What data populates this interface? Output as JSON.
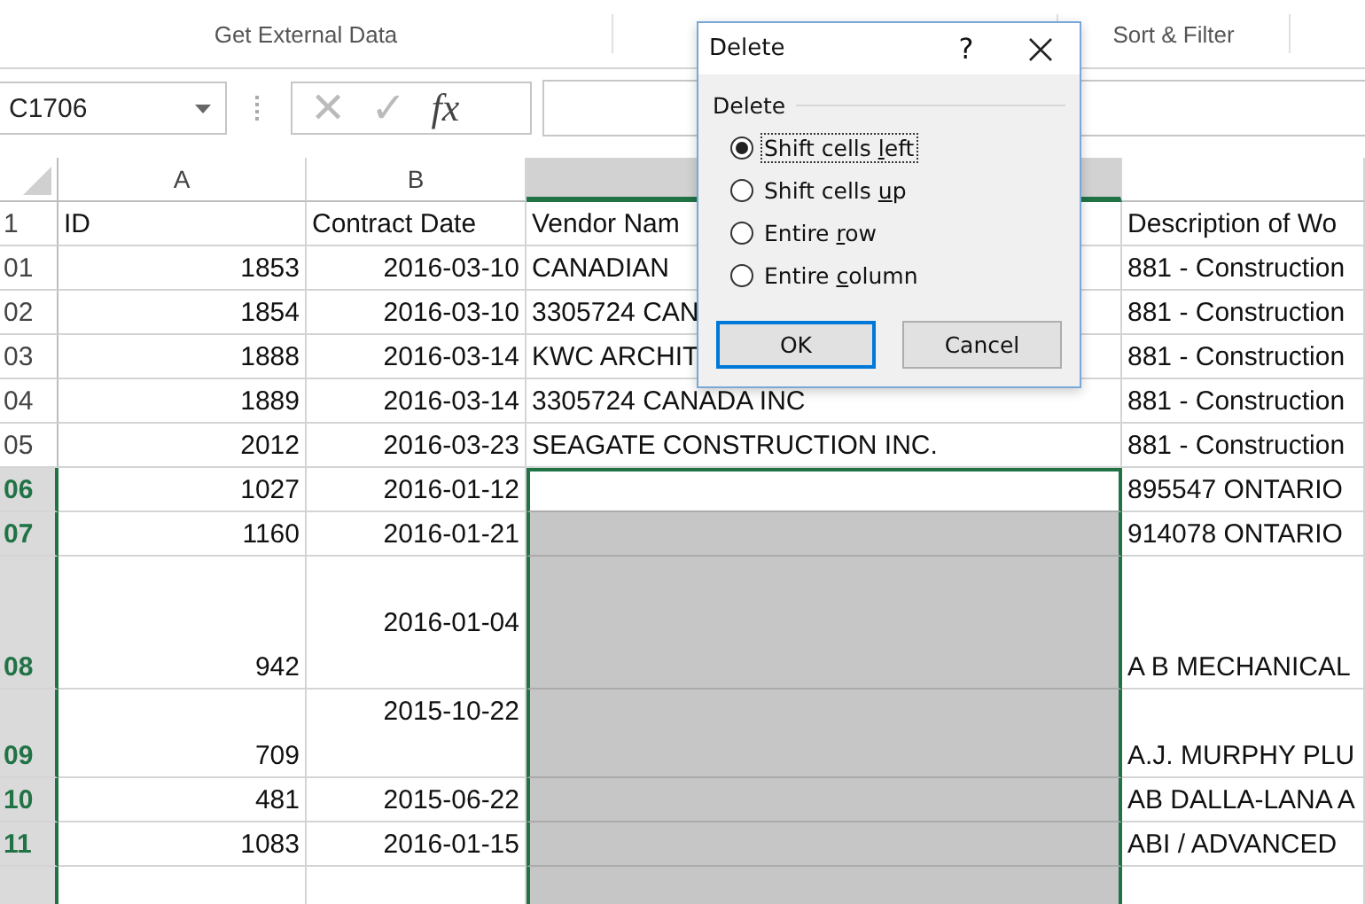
{
  "ribbon_groups": [
    "Get External Data",
    "Sort & Filter"
  ],
  "formula_bar": {
    "name_box": "C1706",
    "cancel_icon": "✕",
    "enter_icon": "✓",
    "function_label": "fx"
  },
  "columns": [
    {
      "label": "A",
      "selected": false
    },
    {
      "label": "B",
      "selected": false
    },
    {
      "selected": true
    },
    {
      "selected": false
    }
  ],
  "rows": [
    {
      "number": "1",
      "kind": "single",
      "selected": false,
      "header": true,
      "id": "ID",
      "date": "Contract Date",
      "vendor": "Vendor Nam",
      "vendor_selected": false,
      "description": "Description of Wo"
    },
    {
      "number": "01",
      "kind": "single",
      "selected": false,
      "id": "1853",
      "date": "2016-03-10",
      "vendor": "CANADIAN",
      "vendor_selected": false,
      "description": "881 - Construction"
    },
    {
      "number": "02",
      "kind": "single",
      "selected": false,
      "id": "1854",
      "date": "2016-03-10",
      "vendor": "3305724 CAN",
      "vendor_selected": false,
      "description": "881 - Construction"
    },
    {
      "number": "03",
      "kind": "single",
      "selected": false,
      "id": "1888",
      "date": "2016-03-14",
      "vendor": "KWC ARCHIT",
      "vendor_selected": false,
      "description": "881 - Construction"
    },
    {
      "number": "04",
      "kind": "single",
      "selected": false,
      "id": "1889",
      "date": "2016-03-14",
      "vendor": "3305724 CANADA INC",
      "vendor_selected": false,
      "description": "881 - Construction"
    },
    {
      "number": "05",
      "kind": "single",
      "selected": false,
      "id": "2012",
      "date": "2016-03-23",
      "vendor": "SEAGATE CONSTRUCTION INC.",
      "vendor_selected": false,
      "description": "881 - Construction"
    },
    {
      "number": "06",
      "kind": "single",
      "selected": true,
      "id": "1027",
      "date": "2016-01-12",
      "vendor_selected": true,
      "active": true,
      "description": "895547 ONTARIO"
    },
    {
      "number": "07",
      "kind": "single",
      "selected": true,
      "id": "1160",
      "date": "2016-01-21",
      "vendor_selected": true,
      "active": false,
      "description": "914078 ONTARIO"
    },
    {
      "number": "08",
      "kind": "triple",
      "selected": true,
      "id": "942",
      "date": "2016-01-04",
      "vendor_selected": true,
      "active": false,
      "description": "A B MECHANICAL"
    },
    {
      "number": "09",
      "kind": "double",
      "selected": true,
      "id": "709",
      "date": "2015-10-22",
      "vendor_selected": true,
      "active": false,
      "description": "A.J. MURPHY PLU"
    },
    {
      "number": "10",
      "kind": "single",
      "selected": true,
      "id": "481",
      "date": "2015-06-22",
      "vendor_selected": true,
      "active": false,
      "description": "AB DALLA-LANA A"
    },
    {
      "number": "11",
      "kind": "single",
      "selected": true,
      "id": "1083",
      "date": "2016-01-15",
      "vendor_selected": true,
      "active": false,
      "description": "ABI  / ADVANCED"
    },
    {
      "kind": "single",
      "selected": true,
      "vendor_selected": true,
      "active": false
    }
  ],
  "dialog": {
    "title": "Delete",
    "help": "?",
    "group": "Delete",
    "options": [
      {
        "before": "Shift cells ",
        "hotkey": "l",
        "after": "eft",
        "selected": true
      },
      {
        "before": "Shift cells ",
        "hotkey": "u",
        "after": "p",
        "selected": false
      },
      {
        "before": "Entire ",
        "hotkey": "r",
        "after": "ow",
        "selected": false
      },
      {
        "before": "Entire ",
        "hotkey": "c",
        "after": "olumn",
        "selected": false
      }
    ],
    "buttons": [
      {
        "label": "OK",
        "focused": true
      },
      {
        "label": "Cancel",
        "focused": false
      }
    ]
  }
}
